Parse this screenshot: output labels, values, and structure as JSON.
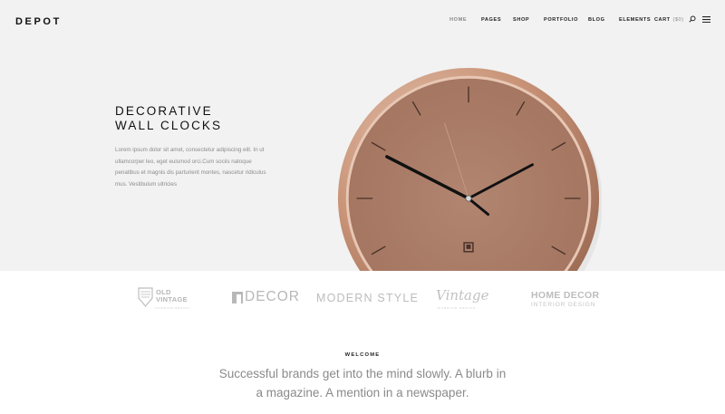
{
  "header": {
    "logo": "DEPOT",
    "nav": [
      {
        "label": "HOME",
        "active": true
      },
      {
        "label": "PAGES"
      },
      {
        "label": "SHOP"
      },
      {
        "label": "PORTFOLIO"
      },
      {
        "label": "BLOG"
      },
      {
        "label": "ELEMENTS"
      }
    ],
    "cart": {
      "label": "CART",
      "amount": "($0)"
    },
    "icons": [
      "search-icon",
      "hamburger-menu-icon"
    ]
  },
  "hero": {
    "title_line1": "DECORATIVE",
    "title_line2": "WALL CLOCKS",
    "text": "Lorem ipsum dolor sit amet, consectetur adipiscing elit. In ut ullamcorper leo, eget euismod orci.Cum sociis natoque penatibus et magnis dis parturient montes, nascetur ridiculus mus. Vestibulum ultricies",
    "image": "copper-wall-clock",
    "colors": {
      "background": "#f2f2f2",
      "copper": "#a87a62"
    }
  },
  "brands": {
    "old_vintage": {
      "line1": "OLD",
      "line2": "VINTAGE",
      "tagline": "INTERIOR DESIGN"
    },
    "decor": {
      "name": "DECOR"
    },
    "modern_style": {
      "name": "MODERN STYLE"
    },
    "vintage": {
      "name": "Vintage",
      "tagline": "INTERIOR DESIGN"
    },
    "home_decor": {
      "name": "HOME DECOR",
      "tagline": "INTERIOR DESIGN"
    }
  },
  "intro": {
    "eyebrow": "WELCOME",
    "blurb": "Successful brands get into the mind slowly. A blurb in a magazine. A mention in a newspaper."
  }
}
